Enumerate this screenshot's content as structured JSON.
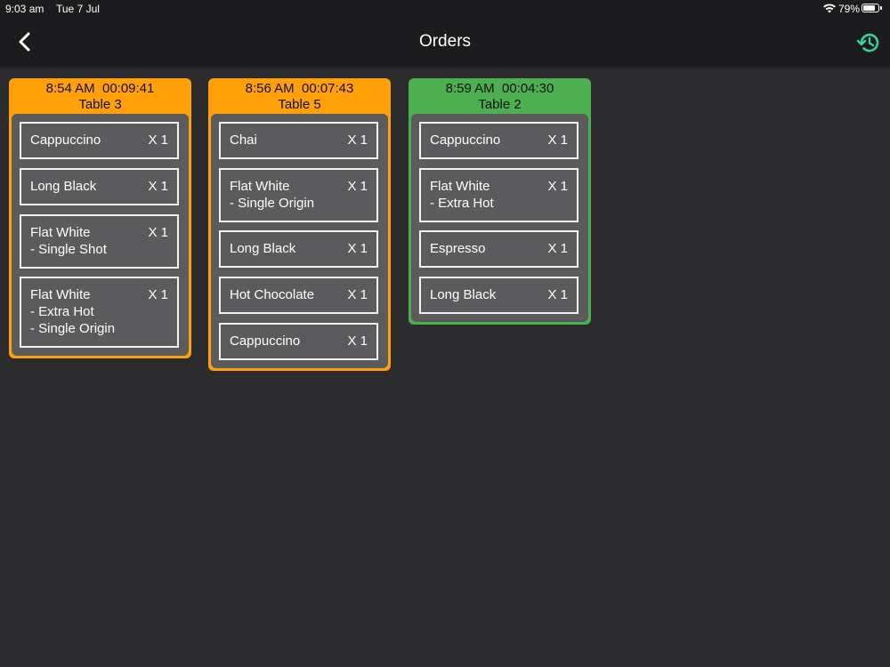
{
  "status_bar": {
    "time": "9:03 am",
    "date": "Tue 7 Jul",
    "battery": "79%",
    "battery_level": 0.79
  },
  "nav": {
    "title": "Orders",
    "back_icon": "chevron-left-icon",
    "history_icon": "history-icon",
    "history_color": "#3ccf9a"
  },
  "colors": {
    "pending": "#ff9f0a",
    "ready": "#4caf50",
    "card_body": "#5b5b5d",
    "background": "#2c2c2e"
  },
  "orders": [
    {
      "time": "8:54 AM  00:09:41",
      "table": "Table 3",
      "status": "pending",
      "items": [
        {
          "name": "Cappuccino",
          "qty": "X 1"
        },
        {
          "name": "Long Black",
          "qty": "X 1"
        },
        {
          "name": "Flat White\n- Single Shot",
          "qty": "X 1"
        },
        {
          "name": "Flat White\n- Extra Hot\n- Single Origin",
          "qty": "X 1"
        }
      ]
    },
    {
      "time": "8:56 AM  00:07:43",
      "table": "Table 5",
      "status": "pending",
      "items": [
        {
          "name": "Chai",
          "qty": "X 1"
        },
        {
          "name": "Flat White\n- Single Origin",
          "qty": "X 1"
        },
        {
          "name": "Long Black",
          "qty": "X 1"
        },
        {
          "name": "Hot Chocolate",
          "qty": "X 1"
        },
        {
          "name": "Cappuccino",
          "qty": "X 1"
        }
      ]
    },
    {
      "time": "8:59 AM  00:04:30",
      "table": "Table 2",
      "status": "ready",
      "items": [
        {
          "name": "Cappuccino",
          "qty": "X 1"
        },
        {
          "name": "Flat White\n- Extra Hot",
          "qty": "X 1"
        },
        {
          "name": "Espresso",
          "qty": "X 1"
        },
        {
          "name": "Long Black",
          "qty": "X 1"
        }
      ]
    }
  ]
}
